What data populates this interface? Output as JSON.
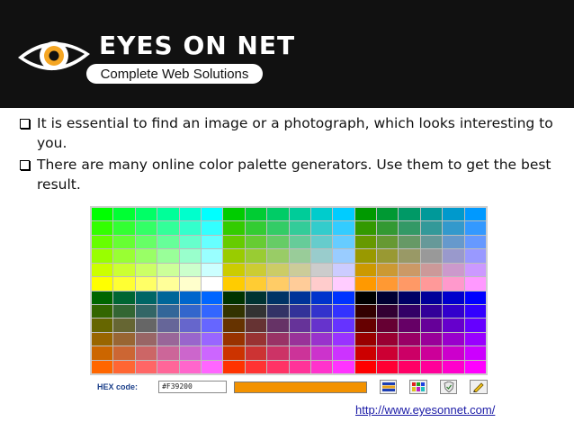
{
  "logo": {
    "title": "EYES ON NET",
    "tagline": "Complete Web Solutions"
  },
  "bullets": [
    {
      "text": "It is essential to find an image or a photograph, which looks interesting to you."
    },
    {
      "text": "There are many online color palette generators. Use them to get the best result."
    }
  ],
  "palette": {
    "rows": [
      [
        "#00ff00",
        "#00ff33",
        "#00ff66",
        "#00ff99",
        "#00ffcc",
        "#00ffff",
        "#00cc00",
        "#00cc33",
        "#00cc66",
        "#00cc99",
        "#00cccc",
        "#00ccff",
        "#009900",
        "#009933",
        "#009966",
        "#009999",
        "#0099cc",
        "#0099ff"
      ],
      [
        "#33ff00",
        "#33ff33",
        "#33ff66",
        "#33ff99",
        "#33ffcc",
        "#33ffff",
        "#33cc00",
        "#33cc33",
        "#33cc66",
        "#33cc99",
        "#33cccc",
        "#33ccff",
        "#339900",
        "#339933",
        "#339966",
        "#339999",
        "#3399cc",
        "#3399ff"
      ],
      [
        "#66ff00",
        "#66ff33",
        "#66ff66",
        "#66ff99",
        "#66ffcc",
        "#66ffff",
        "#66cc00",
        "#66cc33",
        "#66cc66",
        "#66cc99",
        "#66cccc",
        "#66ccff",
        "#669900",
        "#669933",
        "#669966",
        "#669999",
        "#6699cc",
        "#6699ff"
      ],
      [
        "#99ff00",
        "#99ff33",
        "#99ff66",
        "#99ff99",
        "#99ffcc",
        "#99ffff",
        "#99cc00",
        "#99cc33",
        "#99cc66",
        "#99cc99",
        "#99cccc",
        "#99ccff",
        "#999900",
        "#999933",
        "#999966",
        "#999999",
        "#9999cc",
        "#9999ff"
      ],
      [
        "#ccff00",
        "#ccff33",
        "#ccff66",
        "#ccff99",
        "#ccffcc",
        "#ccffff",
        "#cccc00",
        "#cccc33",
        "#cccc66",
        "#cccc99",
        "#cccccc",
        "#ccccff",
        "#cc9900",
        "#cc9933",
        "#cc9966",
        "#cc9999",
        "#cc99cc",
        "#cc99ff"
      ],
      [
        "#ffff00",
        "#ffff33",
        "#ffff66",
        "#ffff99",
        "#ffffcc",
        "#ffffff",
        "#ffcc00",
        "#ffcc33",
        "#ffcc66",
        "#ffcc99",
        "#ffcccc",
        "#ffccff",
        "#ff9900",
        "#ff9933",
        "#ff9966",
        "#ff9999",
        "#ff99cc",
        "#ff99ff"
      ],
      [
        "#006600",
        "#006633",
        "#006666",
        "#006699",
        "#0066cc",
        "#0066ff",
        "#003300",
        "#003333",
        "#003366",
        "#003399",
        "#0033cc",
        "#0033ff",
        "#000000",
        "#000033",
        "#000066",
        "#000099",
        "#0000cc",
        "#0000ff"
      ],
      [
        "#336600",
        "#336633",
        "#336666",
        "#336699",
        "#3366cc",
        "#3366ff",
        "#333300",
        "#333333",
        "#333366",
        "#333399",
        "#3333cc",
        "#3333ff",
        "#330000",
        "#330033",
        "#330066",
        "#330099",
        "#3300cc",
        "#3300ff"
      ],
      [
        "#666600",
        "#666633",
        "#666666",
        "#666699",
        "#6666cc",
        "#6666ff",
        "#663300",
        "#663333",
        "#663366",
        "#663399",
        "#6633cc",
        "#6633ff",
        "#660000",
        "#660033",
        "#660066",
        "#660099",
        "#6600cc",
        "#6600ff"
      ],
      [
        "#996600",
        "#996633",
        "#996666",
        "#996699",
        "#9966cc",
        "#9966ff",
        "#993300",
        "#993333",
        "#993366",
        "#993399",
        "#9933cc",
        "#9933ff",
        "#990000",
        "#990033",
        "#990066",
        "#990099",
        "#9900cc",
        "#9900ff"
      ],
      [
        "#cc6600",
        "#cc6633",
        "#cc6666",
        "#cc6699",
        "#cc66cc",
        "#cc66ff",
        "#cc3300",
        "#cc3333",
        "#cc3366",
        "#cc3399",
        "#cc33cc",
        "#cc33ff",
        "#cc0000",
        "#cc0033",
        "#cc0066",
        "#cc0099",
        "#cc00cc",
        "#cc00ff"
      ],
      [
        "#ff6600",
        "#ff6633",
        "#ff6666",
        "#ff6699",
        "#ff66cc",
        "#ff66ff",
        "#ff3300",
        "#ff3333",
        "#ff3366",
        "#ff3399",
        "#ff33cc",
        "#ff33ff",
        "#ff0000",
        "#ff0033",
        "#ff0066",
        "#ff0099",
        "#ff00cc",
        "#ff00ff"
      ]
    ],
    "hex_label": "HEX code:",
    "hex_value": "#F39200",
    "preview_color": "#F39200",
    "tools": [
      "color-bars-icon",
      "grid-palette-icon",
      "shield-check-icon",
      "pencil-icon"
    ]
  },
  "url": "http://www.eyesonnet.com/",
  "colors": {
    "header_bg": "#111111",
    "url": "#1a1aa6",
    "hex_label": "#1b3f8a",
    "logo_accent": "#f5a623"
  }
}
